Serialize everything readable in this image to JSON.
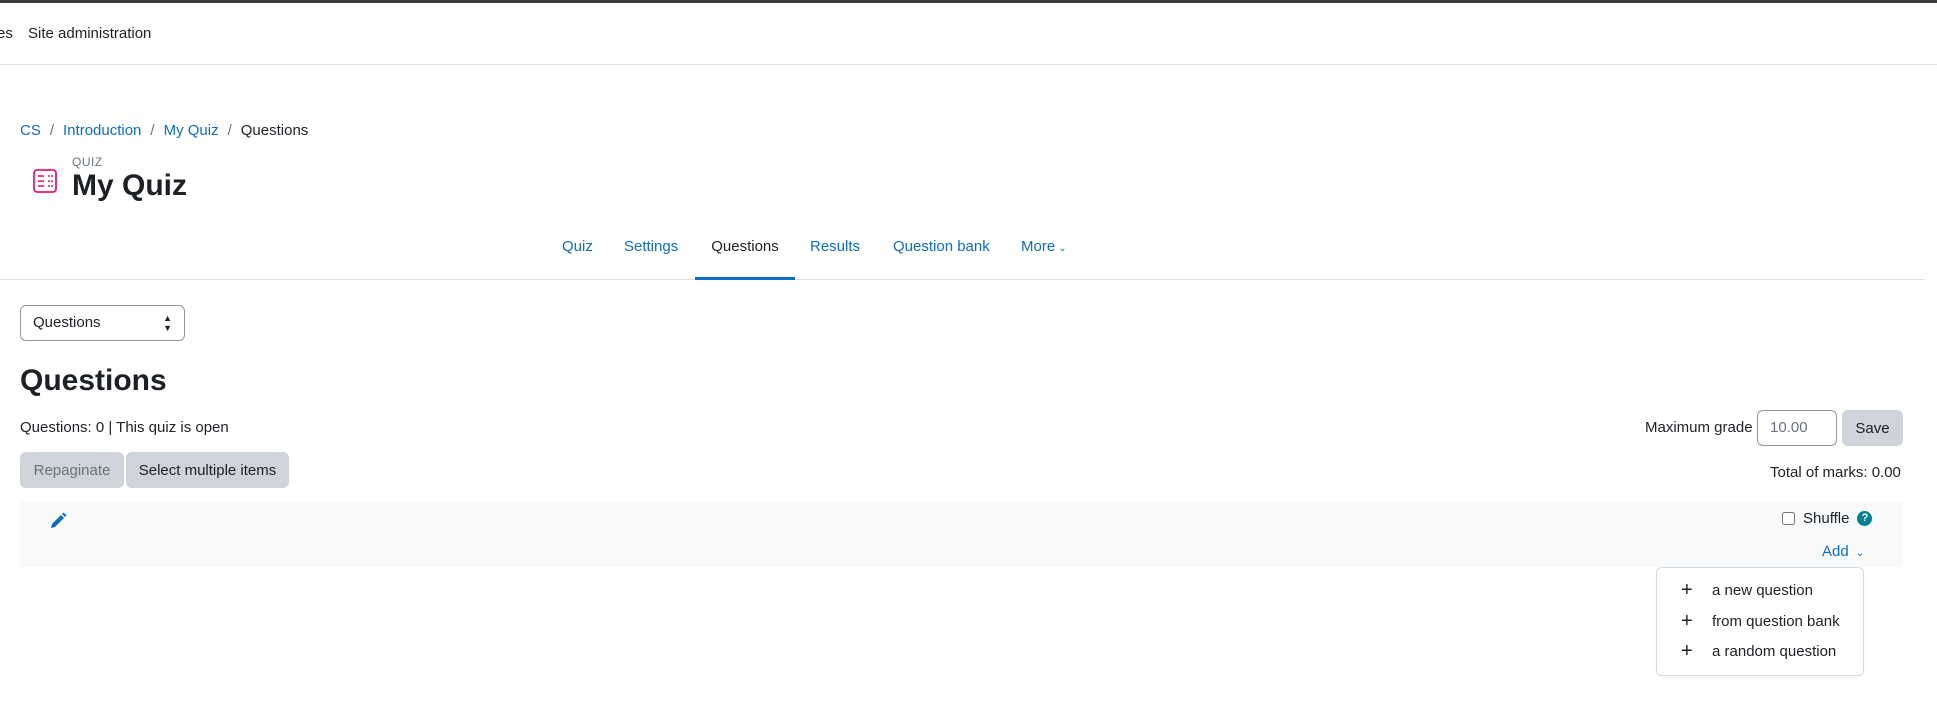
{
  "topnav": {
    "items": [
      "es",
      "Site administration"
    ]
  },
  "breadcrumb": {
    "items": [
      "CS",
      "Introduction",
      "My Quiz"
    ],
    "current": "Questions",
    "separator": "/"
  },
  "header": {
    "label": "QUIZ",
    "title": "My Quiz"
  },
  "tabs": [
    {
      "label": "Quiz"
    },
    {
      "label": "Settings"
    },
    {
      "label": "Questions"
    },
    {
      "label": "Results"
    },
    {
      "label": "Question bank"
    },
    {
      "label": "More"
    }
  ],
  "jump_select": {
    "value": "Questions"
  },
  "main": {
    "heading": "Questions",
    "status": "Questions: 0 | This quiz is open",
    "repaginate_label": "Repaginate",
    "select_multiple_label": "Select multiple items",
    "max_grade_label": "Maximum grade",
    "max_grade_value": "10.00",
    "save_label": "Save",
    "total_marks": "Total of marks: 0.00",
    "shuffle_label": "Shuffle",
    "add_label": "Add"
  },
  "add_menu": {
    "items": [
      "a new question",
      "from question bank",
      "a random question"
    ]
  },
  "colors": {
    "link": "#0f6cbf",
    "quiz_icon": "#e11d7a",
    "help_icon": "#008196",
    "button_bg": "#ced4da"
  }
}
